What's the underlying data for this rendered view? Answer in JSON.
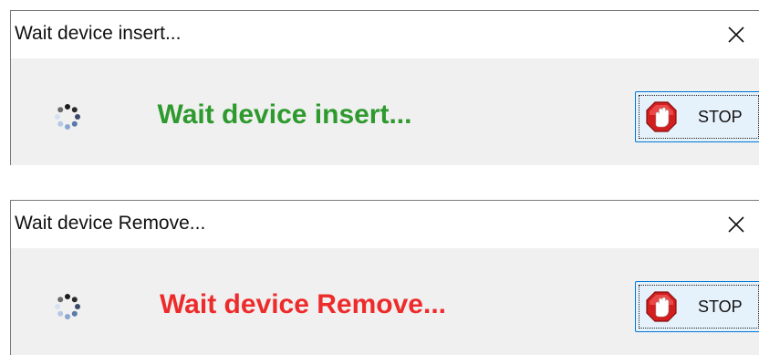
{
  "dialogs": [
    {
      "title": "Wait device insert...",
      "status_text": "Wait device insert...",
      "status_color": "#2e9a2e",
      "stop_label": "STOP"
    },
    {
      "title": "Wait device Remove...",
      "status_text": "Wait device Remove...",
      "status_color": "#ee2b2b",
      "stop_label": "STOP"
    }
  ],
  "icons": {
    "close": "close-icon",
    "spinner": "loading-spinner-icon",
    "stop": "stop-hand-icon"
  },
  "colors": {
    "focus_border": "#0078d7",
    "button_bg": "#e5f1fb",
    "content_bg": "#f0f0f0"
  }
}
